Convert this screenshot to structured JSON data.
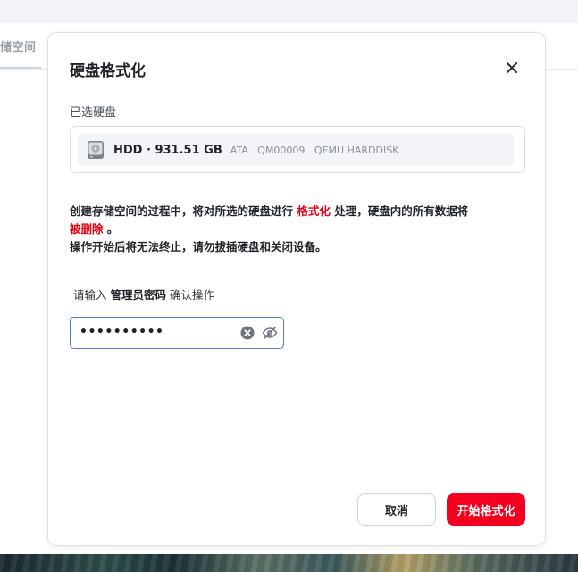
{
  "background": {
    "tab_label": "储空间"
  },
  "modal": {
    "title": "硬盘格式化",
    "selected_disks_label": "已选硬盘",
    "disk": {
      "name": "HDD · 931.51 GB",
      "meta": "ATA   QM00009   QEMU HARDDISK"
    },
    "warning": {
      "part1": "创建存储空间的过程中，将对所选的硬盘进行 ",
      "format_word": "格式化",
      "part2": " 处理，硬盘内的所有数据将",
      "deleted_word": "被删除",
      "part3": " 。",
      "line2": "操作开始后将无法终止，请勿拔插硬盘和关闭设备。"
    },
    "confirm": {
      "prefix": "请输入 ",
      "bold": "管理员密码",
      "suffix": " 确认操作"
    },
    "password_field": {
      "value": "••••••••••"
    },
    "buttons": {
      "cancel": "取消",
      "start_format": "开始格式化"
    }
  },
  "colors": {
    "danger": "#e60012",
    "primary_button": "#f4001e",
    "focus_border": "#4d7fd1"
  },
  "icons": [
    "close-icon",
    "hard-disk-icon",
    "clear-icon",
    "eye-off-icon"
  ]
}
